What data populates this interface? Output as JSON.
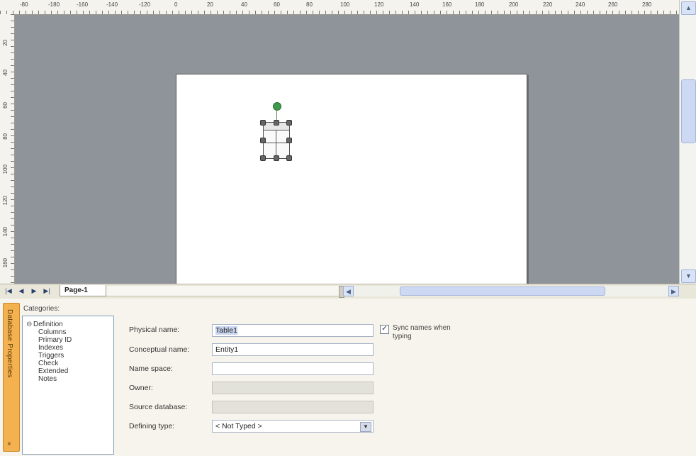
{
  "ruler": {
    "top_ticks": [
      "-80",
      "-180",
      "-160",
      "-140",
      "-120",
      "0",
      "20",
      "40",
      "60",
      "80",
      "100",
      "120",
      "140",
      "160",
      "180",
      "200",
      "220",
      "240",
      "260",
      "280"
    ],
    "left_ticks": [
      "20",
      "40",
      "60",
      "80",
      "100",
      "120",
      "140",
      "160"
    ]
  },
  "entity": {
    "name": "Table1"
  },
  "scrollbar": {
    "up": "▲",
    "down": "▼",
    "left": "◀",
    "right": "▶"
  },
  "page_nav": {
    "first": "|◀",
    "prev": "◀",
    "next": "▶",
    "last": "▶|",
    "page_tab": "Page-1"
  },
  "panel": {
    "title": "Database Properties",
    "close": "×",
    "categories_label": "Categories:",
    "categories": {
      "root": {
        "symbol": "⊖",
        "label": "Definition"
      },
      "children": [
        "Columns",
        "Primary ID",
        "Indexes",
        "Triggers",
        "Check",
        "Extended",
        "Notes"
      ]
    },
    "fields": {
      "physical_name": {
        "label": "Physical name:",
        "value": "Table1"
      },
      "conceptual_name": {
        "label": "Conceptual name:",
        "value": "Entity1"
      },
      "name_space": {
        "label": "Name space:",
        "value": ""
      },
      "owner": {
        "label": "Owner:",
        "value": ""
      },
      "source_database": {
        "label": "Source database:",
        "value": ""
      },
      "defining_type": {
        "label": "Defining type:",
        "value": "<   Not Typed   >"
      }
    },
    "sync_names": {
      "checked_mark": "✓",
      "label": "Sync names when typing"
    }
  }
}
